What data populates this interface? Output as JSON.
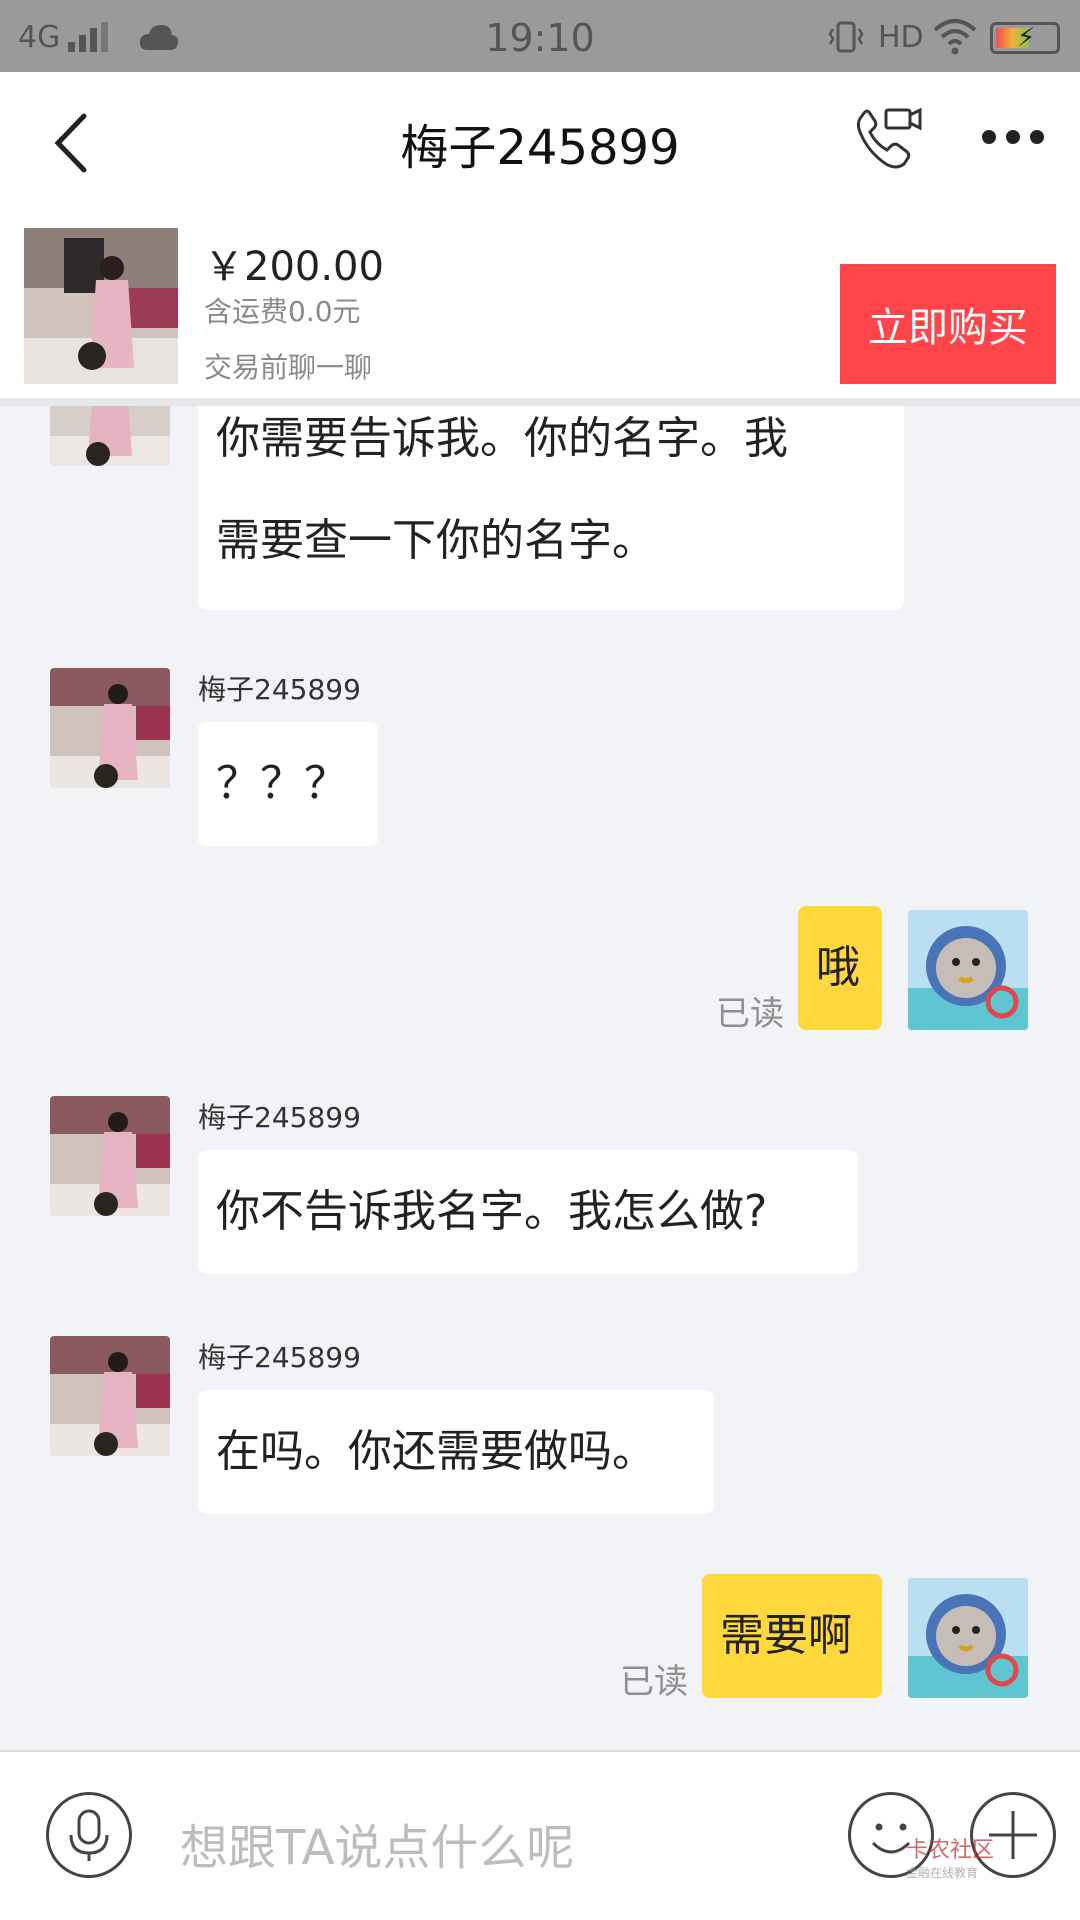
{
  "status_bar": {
    "network": "4G",
    "time": "19:10",
    "hd": "HD"
  },
  "header": {
    "title": "梅子245899"
  },
  "product": {
    "price": "￥200.00",
    "shipping": "含运费0.0元",
    "chat_hint": "交易前聊一聊",
    "buy_label": "立即购买"
  },
  "messages": [
    {
      "from": "other",
      "sender": "",
      "lines": [
        "你需要告诉我。你的名字。我",
        "需要查一下你的名字。"
      ]
    },
    {
      "from": "other",
      "sender": "梅子245899",
      "text": "？？？"
    },
    {
      "from": "me",
      "text": "哦",
      "status": "已读"
    },
    {
      "from": "other",
      "sender": "梅子245899",
      "text": "你不告诉我名字。我怎么做?"
    },
    {
      "from": "other",
      "sender": "梅子245899",
      "text": "在吗。你还需要做吗。"
    },
    {
      "from": "me",
      "text": "需要啊",
      "status": "已读"
    }
  ],
  "input": {
    "placeholder": "想跟TA说点什么呢"
  },
  "watermark": {
    "title": "卡农社区",
    "subtitle": "金融在线教育"
  },
  "colors": {
    "buy_button": "#ff444a",
    "my_bubble": "#ffd83d",
    "chat_bg": "#f2f3f7"
  },
  "icons": [
    "back-icon",
    "video-call-icon",
    "more-icon",
    "mic-icon",
    "emoji-icon",
    "plus-icon"
  ]
}
